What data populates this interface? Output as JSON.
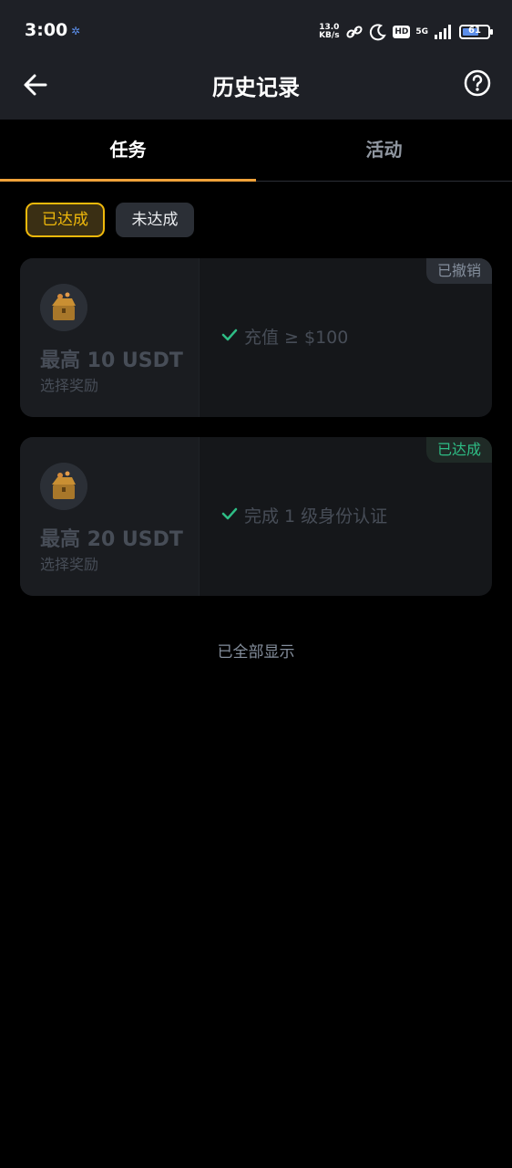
{
  "status_bar": {
    "time": "3:00",
    "net_speed_value": "13.0",
    "net_speed_unit": "KB/s",
    "hd": "HD",
    "network": "5G",
    "battery": "61"
  },
  "header": {
    "title": "历史记录"
  },
  "tabs": [
    {
      "label": "任务"
    },
    {
      "label": "活动"
    }
  ],
  "filters": [
    {
      "label": "已达成"
    },
    {
      "label": "未达成"
    }
  ],
  "tasks": [
    {
      "reward_title": "最高 10 USDT",
      "reward_sub": "选择奖励",
      "requirement": "充值 ≥ $100",
      "status": "已撤销"
    },
    {
      "reward_title": "最高 20 USDT",
      "reward_sub": "选择奖励",
      "requirement": "完成 1 级身份认证",
      "status": "已达成"
    }
  ],
  "footer": {
    "note": "已全部显示"
  },
  "colors": {
    "accent": "#f0b90b",
    "success": "#2ebd85",
    "background": "#000000",
    "surface": "#1e2026"
  }
}
